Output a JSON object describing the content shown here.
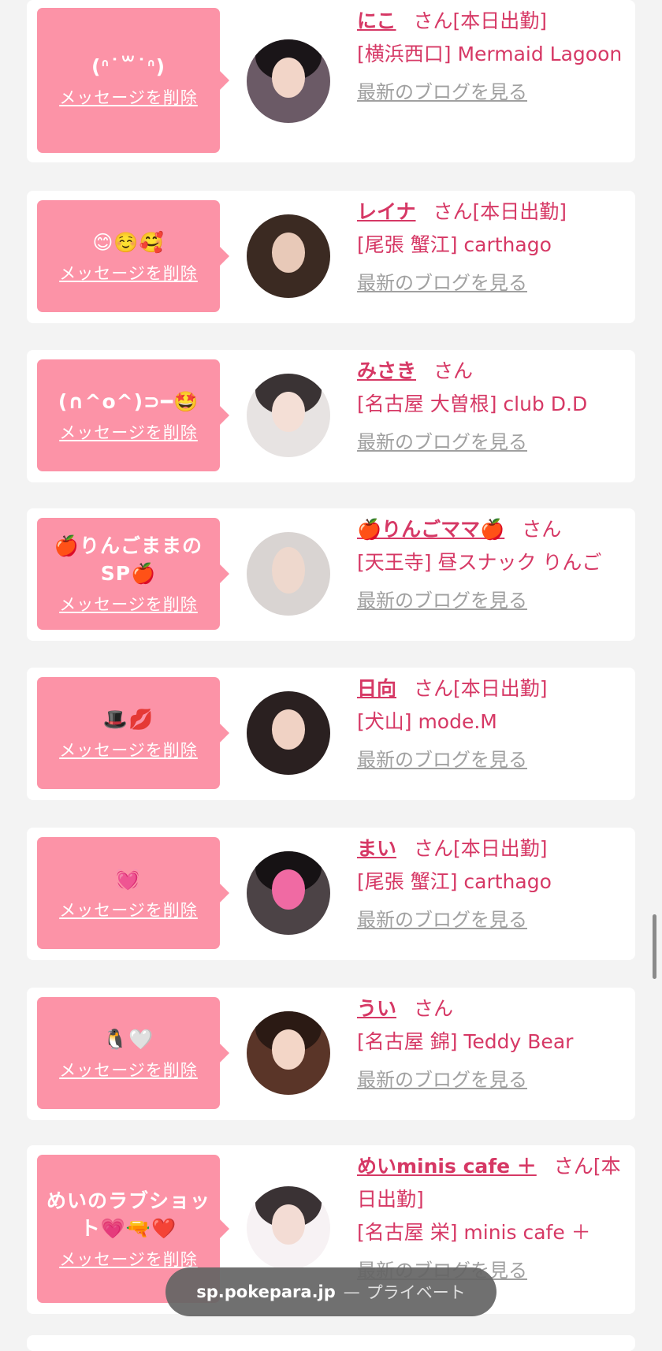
{
  "cards": [
    {
      "message": "(ᐢ˙꒳˙ᐢ)",
      "delete_label": "メッセージを削除",
      "name": "にこ",
      "san": "さん",
      "status": "[本日出勤]",
      "shop": "[横浜西口] Mermaid Lagoon",
      "blog_label": "最新のブログを見る"
    },
    {
      "message": "😊☺️🥰",
      "delete_label": "メッセージを削除",
      "name": "レイナ",
      "san": "さん",
      "status": "[本日出勤]",
      "shop": "[尾張 蟹江] carthago",
      "blog_label": "最新のブログを見る"
    },
    {
      "message": "(∩^o^)⊃━🤩",
      "delete_label": "メッセージを削除",
      "name": "みさき",
      "san": "さん",
      "status": "",
      "shop": "[名古屋 大曽根] club D.D",
      "blog_label": "最新のブログを見る"
    },
    {
      "message": "🍎りんごままのSP🍎",
      "delete_label": "メッセージを削除",
      "name": "🍎りんごママ🍎",
      "san": "さん",
      "status": "",
      "shop": "[天王寺] 昼スナック りんご",
      "blog_label": "最新のブログを見る"
    },
    {
      "message": "🎩💋",
      "delete_label": "メッセージを削除",
      "name": "日向",
      "san": "さん",
      "status": "[本日出勤]",
      "shop": "[犬山] mode.M",
      "blog_label": "最新のブログを見る"
    },
    {
      "message": "💓",
      "delete_label": "メッセージを削除",
      "name": "まい",
      "san": "さん",
      "status": "[本日出勤]",
      "shop": "[尾張 蟹江] carthago",
      "blog_label": "最新のブログを見る"
    },
    {
      "message": "🐧🤍",
      "delete_label": "メッセージを削除",
      "name": "うい",
      "san": "さん",
      "status": "",
      "shop": "[名古屋 錦] Teddy Bear",
      "blog_label": "最新のブログを見る"
    },
    {
      "message": "めいのラブショット💗🔫❤️",
      "delete_label": "メッセージを削除",
      "name": "めいminis cafe ＋",
      "san": "さん",
      "status": "[本日出勤]",
      "shop": "[名古屋 栄] minis cafe ＋",
      "blog_label": "最新のブログを見る"
    }
  ],
  "url_bar": {
    "domain": "sp.pokepara.jp",
    "separator": "—",
    "mode": "プライベート"
  }
}
